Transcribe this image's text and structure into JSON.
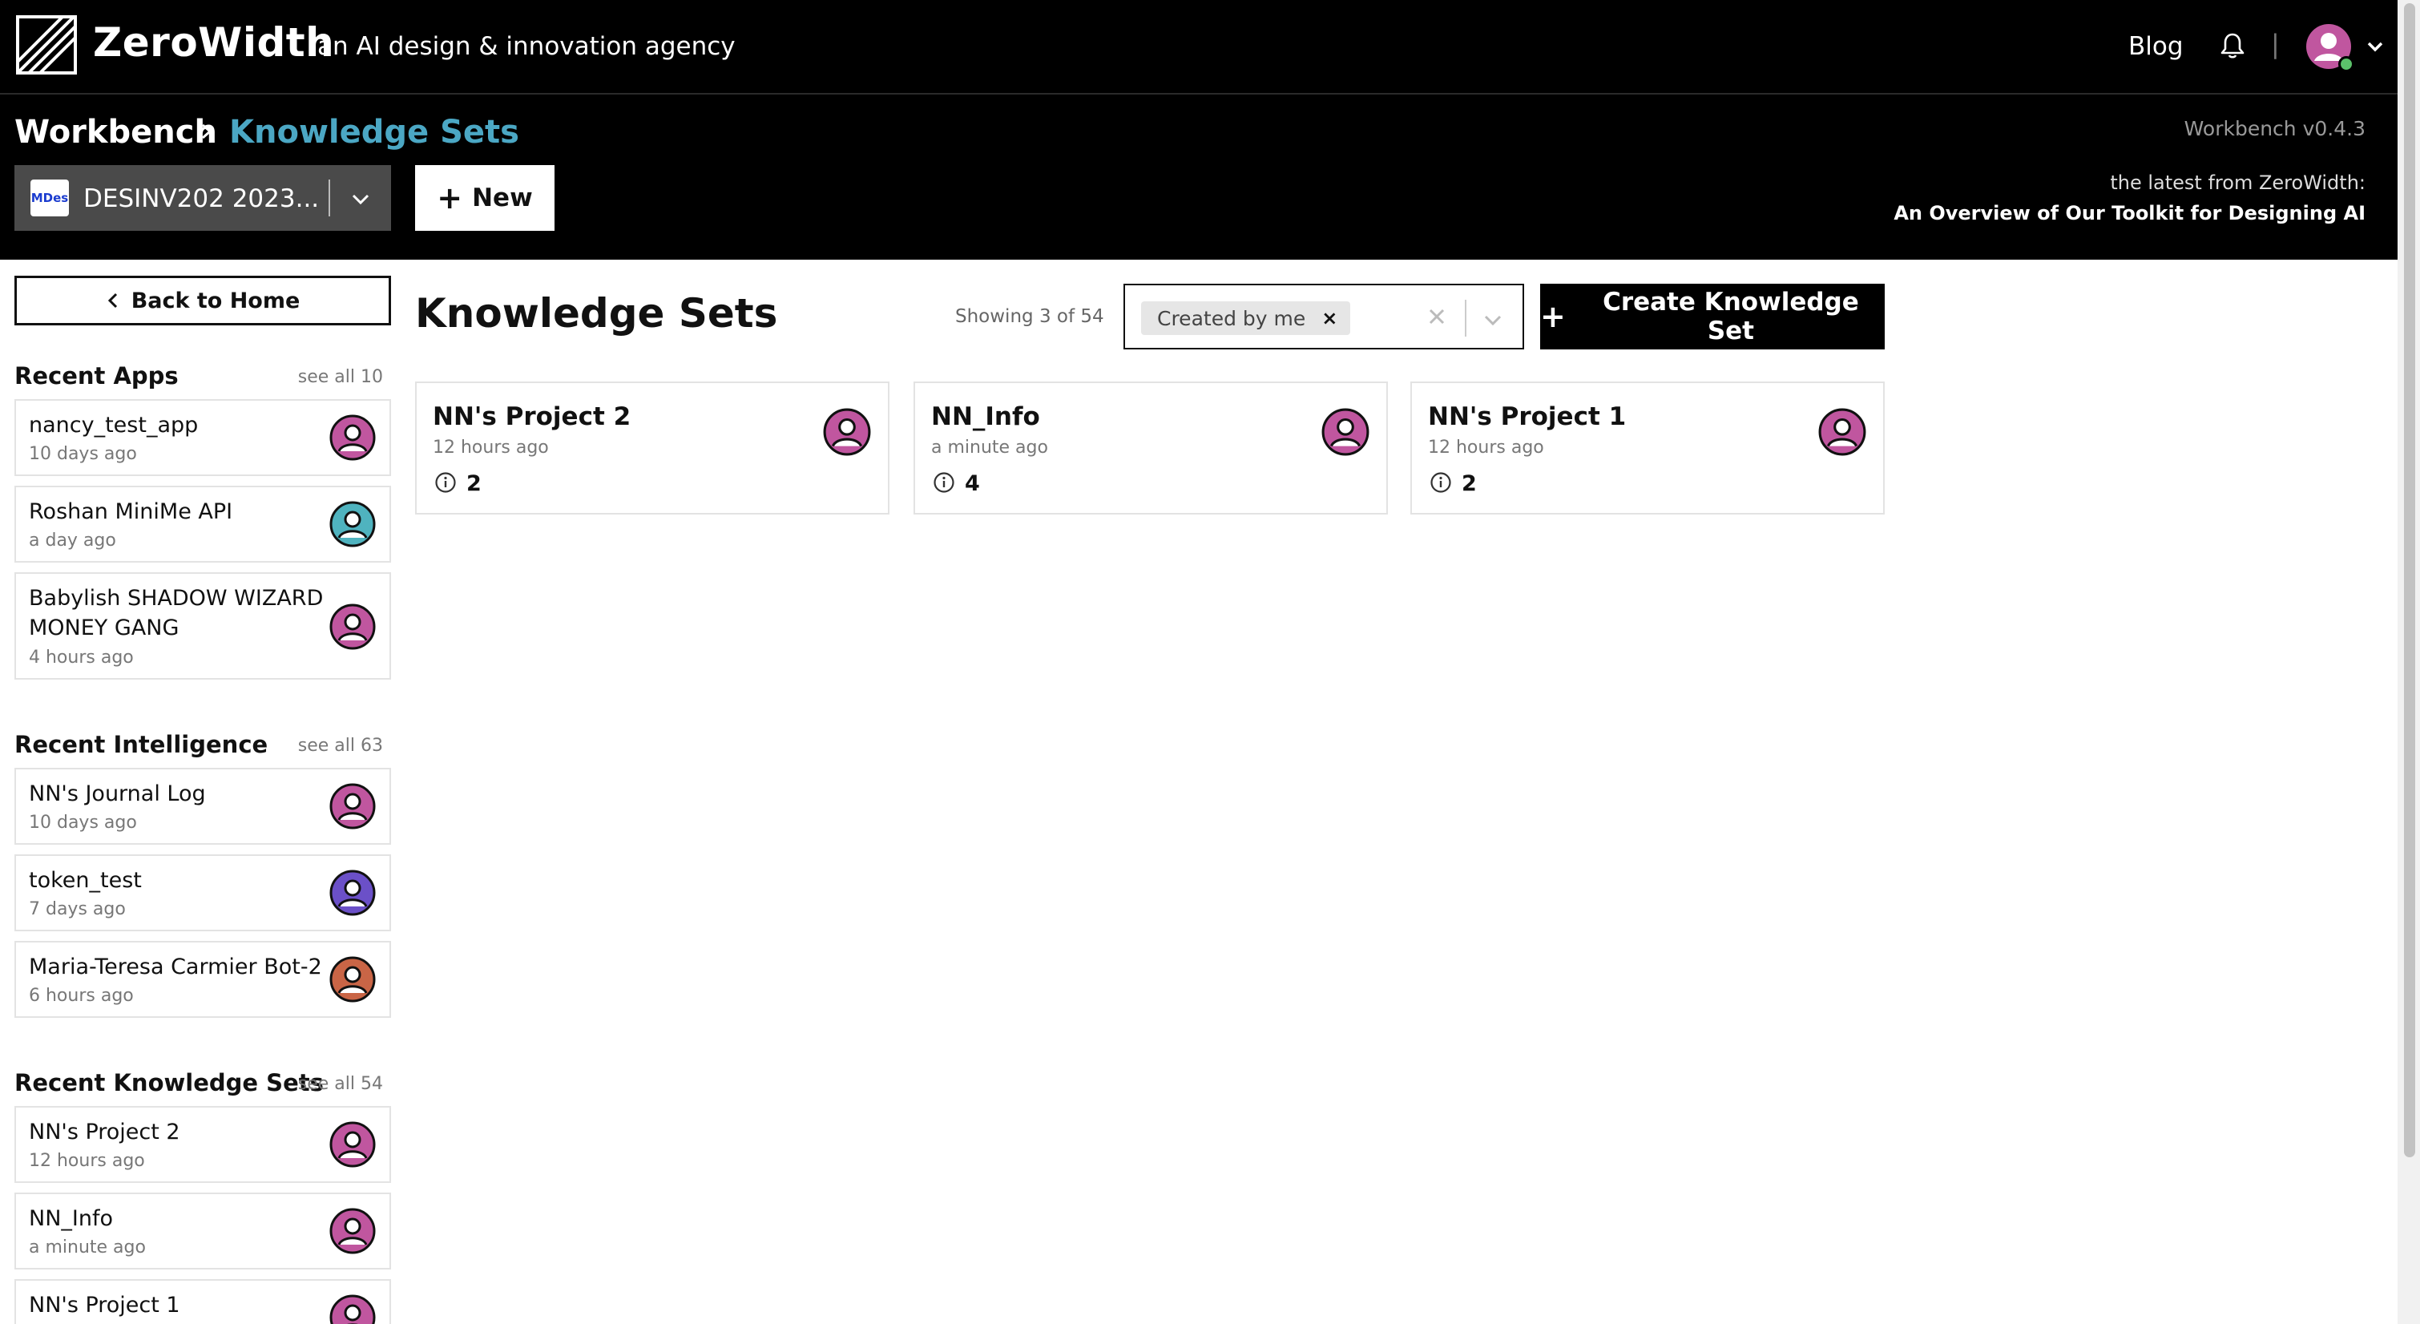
{
  "topnav": {
    "brand": "ZeroWidth",
    "tagline": "an AI design & innovation agency",
    "blog_label": "Blog",
    "icons": [
      "zerowidth-logo-icon",
      "bell-icon",
      "user-avatar-icon",
      "chevron-down-icon"
    ]
  },
  "subheader": {
    "breadcrumb_root": "Workbench",
    "breadcrumb_current": "Knowledge Sets",
    "version": "Workbench v0.4.3",
    "latest_label": "the latest from ZeroWidth:",
    "latest_link": "An Overview of Our Toolkit for Designing AI",
    "org": {
      "badge": "MDes",
      "name": "DESINV202 2023..."
    },
    "new_label": "New"
  },
  "sidebar": {
    "back_label": "Back to Home",
    "sections": [
      {
        "title": "Recent Apps",
        "see_all": "see all 10",
        "items": [
          {
            "name": "nancy_test_app",
            "time": "10 days ago",
            "avatar_color": "#c0569f"
          },
          {
            "name": "Roshan MiniMe API",
            "time": "a day ago",
            "avatar_color": "#4fb3bf"
          },
          {
            "name": "Babylish SHADOW WIZARD MONEY GANG",
            "time": "4 hours ago",
            "avatar_color": "#c0569f"
          }
        ]
      },
      {
        "title": "Recent Intelligence",
        "see_all": "see all 63",
        "items": [
          {
            "name": "NN's Journal Log",
            "time": "10 days ago",
            "avatar_color": "#c0569f"
          },
          {
            "name": "token_test",
            "time": "7 days ago",
            "avatar_color": "#6b50c8"
          },
          {
            "name": "Maria-Teresa Carmier Bot-2",
            "time": "6 hours ago",
            "avatar_color": "#c96546"
          }
        ]
      },
      {
        "title": "Recent Knowledge Sets",
        "see_all": "see all 54",
        "items": [
          {
            "name": "NN's Project 2",
            "time": "12 hours ago",
            "avatar_color": "#c0569f"
          },
          {
            "name": "NN_Info",
            "time": "a minute ago",
            "avatar_color": "#c0569f"
          },
          {
            "name": "NN's Project 1",
            "time": "",
            "avatar_color": "#c0569f"
          }
        ]
      }
    ]
  },
  "main": {
    "title": "Knowledge Sets",
    "showing": "Showing 3 of 54",
    "filter_chip": "Created by me",
    "chip_remove": "×",
    "create_label": "Create Knowledge Set",
    "cards": [
      {
        "name": "NN's Project 2",
        "time": "12 hours ago",
        "count": "2",
        "avatar_color": "#c0569f"
      },
      {
        "name": "NN_Info",
        "time": "a minute ago",
        "count": "4",
        "avatar_color": "#c0569f"
      },
      {
        "name": "NN's Project 1",
        "time": "12 hours ago",
        "count": "2",
        "avatar_color": "#c0569f"
      }
    ]
  },
  "colors": {
    "header_bg": "#000000",
    "accent_breadcrumb": "#4ba7c4",
    "avatar_pink": "#c0569f",
    "online": "#5bc16a"
  }
}
